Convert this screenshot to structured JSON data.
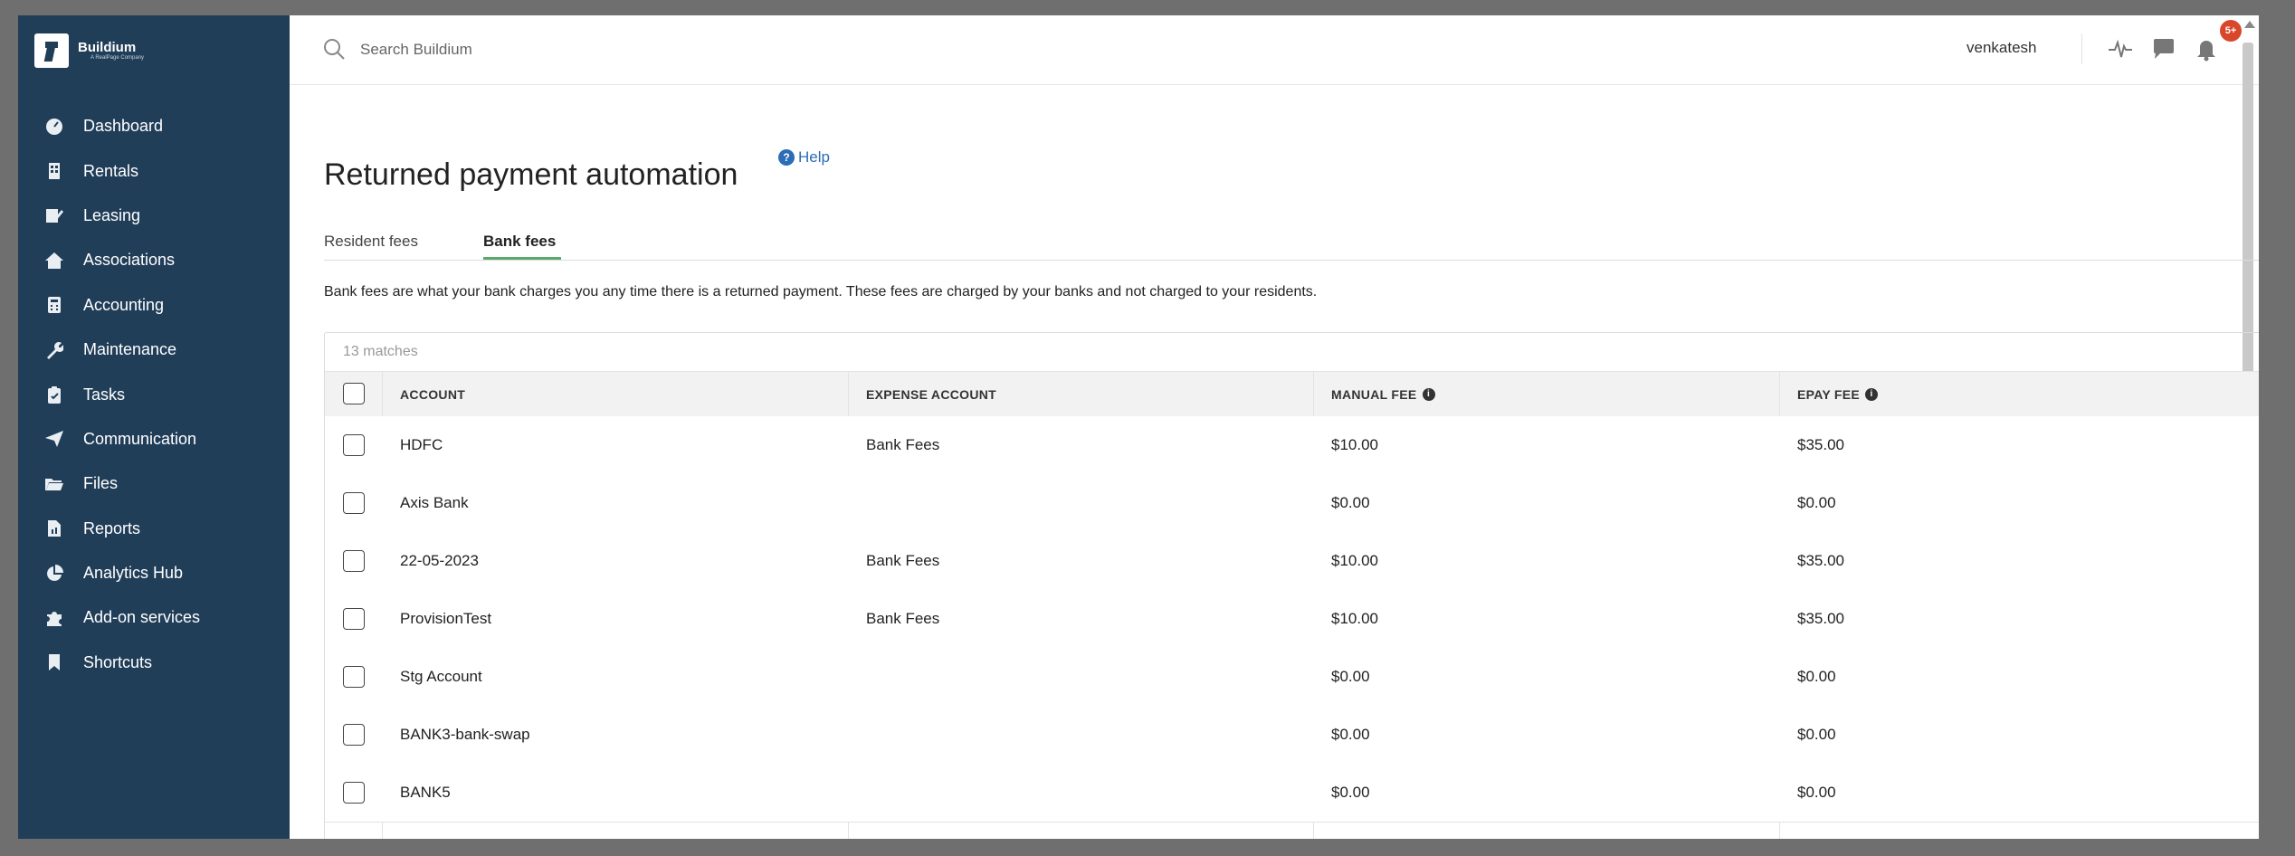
{
  "app": {
    "logo_name": "Buildium",
    "logo_sub": "A RealPage Company"
  },
  "sidebar": {
    "items": [
      {
        "label": "Dashboard",
        "icon": "dashboard-icon"
      },
      {
        "label": "Rentals",
        "icon": "building-icon"
      },
      {
        "label": "Leasing",
        "icon": "leasing-icon"
      },
      {
        "label": "Associations",
        "icon": "home-icon"
      },
      {
        "label": "Accounting",
        "icon": "calculator-icon"
      },
      {
        "label": "Maintenance",
        "icon": "wrench-icon"
      },
      {
        "label": "Tasks",
        "icon": "clipboard-icon"
      },
      {
        "label": "Communication",
        "icon": "paper-plane-icon"
      },
      {
        "label": "Files",
        "icon": "folder-icon"
      },
      {
        "label": "Reports",
        "icon": "report-icon"
      },
      {
        "label": "Analytics Hub",
        "icon": "pie-chart-icon"
      },
      {
        "label": "Add-on services",
        "icon": "puzzle-icon"
      },
      {
        "label": "Shortcuts",
        "icon": "bookmark-icon"
      }
    ]
  },
  "topbar": {
    "search_placeholder": "Search Buildium",
    "username": "venkatesh",
    "notification_badge": "5+"
  },
  "page": {
    "title": "Returned payment automation",
    "help_label": "Help",
    "tabs": [
      {
        "label": "Resident fees",
        "active": false
      },
      {
        "label": "Bank fees",
        "active": true
      }
    ],
    "description": "Bank fees are what your bank charges you any time there is a returned payment. These fees are charged by your banks and not charged to your residents."
  },
  "table": {
    "matches": "13 matches",
    "headers": {
      "account": "ACCOUNT",
      "expense_account": "EXPENSE ACCOUNT",
      "manual_fee": "MANUAL FEE",
      "epay_fee": "EPAY FEE"
    },
    "rows": [
      {
        "account": "HDFC",
        "expense_account": "Bank Fees",
        "manual_fee": "$10.00",
        "epay_fee": "$35.00"
      },
      {
        "account": "Axis Bank",
        "expense_account": "",
        "manual_fee": "$0.00",
        "epay_fee": "$0.00"
      },
      {
        "account": "22-05-2023",
        "expense_account": "Bank Fees",
        "manual_fee": "$10.00",
        "epay_fee": "$35.00"
      },
      {
        "account": "ProvisionTest",
        "expense_account": "Bank Fees",
        "manual_fee": "$10.00",
        "epay_fee": "$35.00"
      },
      {
        "account": "Stg Account",
        "expense_account": "",
        "manual_fee": "$0.00",
        "epay_fee": "$0.00"
      },
      {
        "account": "BANK3-bank-swap",
        "expense_account": "",
        "manual_fee": "$0.00",
        "epay_fee": "$0.00"
      },
      {
        "account": "BANK5",
        "expense_account": "",
        "manual_fee": "$0.00",
        "epay_fee": "$0.00"
      }
    ]
  },
  "colors": {
    "sidebar_bg": "#213e59",
    "accent_green": "#5aa96a",
    "link_blue": "#2d6db5",
    "badge_red": "#d9472b"
  }
}
